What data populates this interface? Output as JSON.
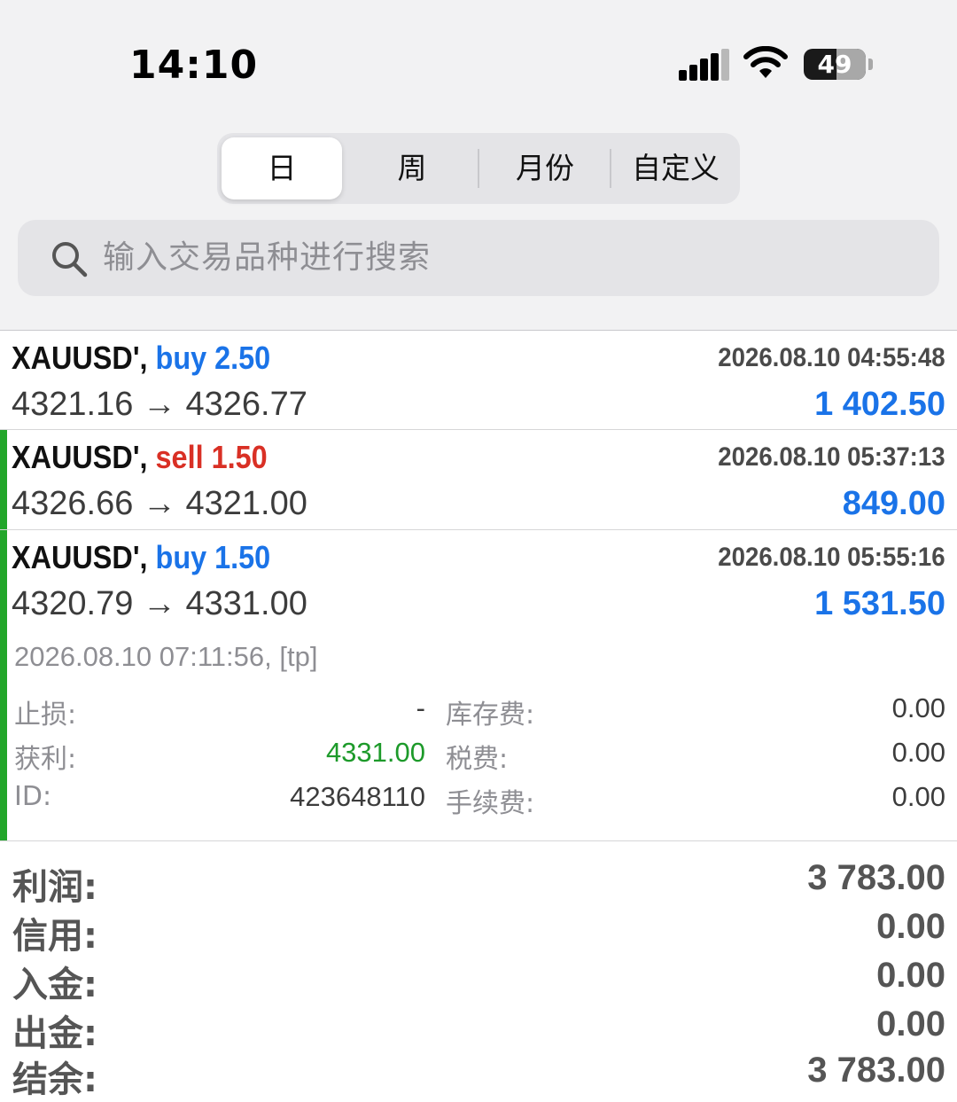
{
  "status_bar": {
    "time": "14:10",
    "battery": "49"
  },
  "period_tabs": [
    {
      "label": "日",
      "active": true
    },
    {
      "label": "周",
      "active": false
    },
    {
      "label": "月份",
      "active": false
    },
    {
      "label": "自定义",
      "active": false
    }
  ],
  "search": {
    "placeholder": "输入交易品种进行搜索"
  },
  "trades": [
    {
      "symbol": "XAUUSD',",
      "side": "buy 2.50",
      "time": "2026.08.10 04:55:48",
      "prices": "4321.16 → 4326.77",
      "profit": "1 402.50"
    },
    {
      "symbol": "XAUUSD',",
      "side": "sell 1.50",
      "time": "2026.08.10 05:37:13",
      "prices": "4326.66 → 4321.00",
      "profit": "849.00"
    },
    {
      "symbol": "XAUUSD',",
      "side": "buy 1.50",
      "time": "2026.08.10 05:55:16",
      "prices": "4320.79 → 4331.00",
      "profit": "1 531.50",
      "details": {
        "close_time": "2026.08.10 07:11:56, [tp]",
        "stop_loss_label": "止损:",
        "stop_loss": "-",
        "take_profit_label": "获利:",
        "take_profit": "4331.00",
        "id_label": "ID:",
        "id": "423648110",
        "swap_label": "库存费:",
        "swap": "0.00",
        "tax_label": "税费:",
        "tax": "0.00",
        "commission_label": "手续费:",
        "commission": "0.00"
      }
    }
  ],
  "summary": [
    {
      "label": "利润:",
      "value": "3 783.00"
    },
    {
      "label": "信用:",
      "value": "0.00"
    },
    {
      "label": "入金:",
      "value": "0.00"
    },
    {
      "label": "出金:",
      "value": "0.00"
    },
    {
      "label": "结余:",
      "value": "3 783.00"
    }
  ],
  "colors": {
    "buy": "#1a73e8",
    "sell": "#d93025",
    "active_bar": "#22a62a",
    "take_profit": "#1d9a2a"
  }
}
